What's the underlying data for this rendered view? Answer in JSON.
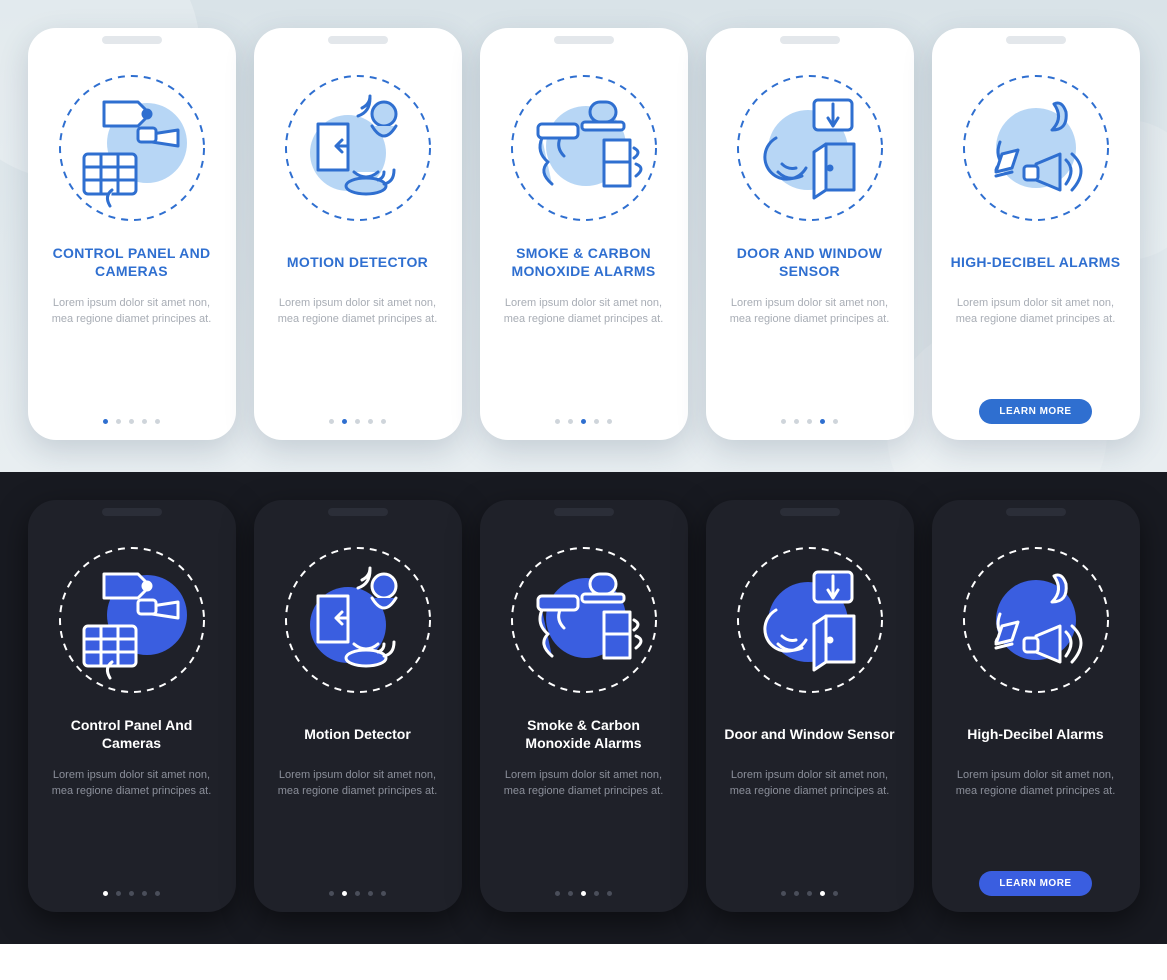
{
  "body_text": "Lorem ipsum dolor sit amet non, mea regione diamet principes at.",
  "button_label": "LEARN MORE",
  "total_dots": 5,
  "screens": [
    {
      "title_light": "CONTROL PANEL AND CAMERAS",
      "title_dark": "Control Panel And Cameras",
      "icon": "control-panel-cameras",
      "active": 0,
      "cta": false
    },
    {
      "title_light": "MOTION DETECTOR",
      "title_dark": "Motion Detector",
      "icon": "motion-detector",
      "active": 1,
      "cta": false
    },
    {
      "title_light": "SMOKE & CARBON MONOXIDE ALARMS",
      "title_dark": "Smoke & Carbon Monoxide Alarms",
      "icon": "smoke-co-alarms",
      "active": 2,
      "cta": false
    },
    {
      "title_light": "DOOR AND WINDOW SENSOR",
      "title_dark": "Door and Window Sensor",
      "icon": "door-window-sensor",
      "active": 3,
      "cta": false
    },
    {
      "title_light": "HIGH-DECIBEL ALARMS",
      "title_dark": "High-Decibel Alarms",
      "icon": "high-decibel-alarms",
      "active": 4,
      "cta": true
    }
  ],
  "colors": {
    "accent_light": "#2f6fd0",
    "accent_dark": "#3a5ee0",
    "illus_fill_light": "#b7d6f5",
    "illus_stroke": "#2f6fd0",
    "illus_fill_dark": "#3a5ee0"
  }
}
